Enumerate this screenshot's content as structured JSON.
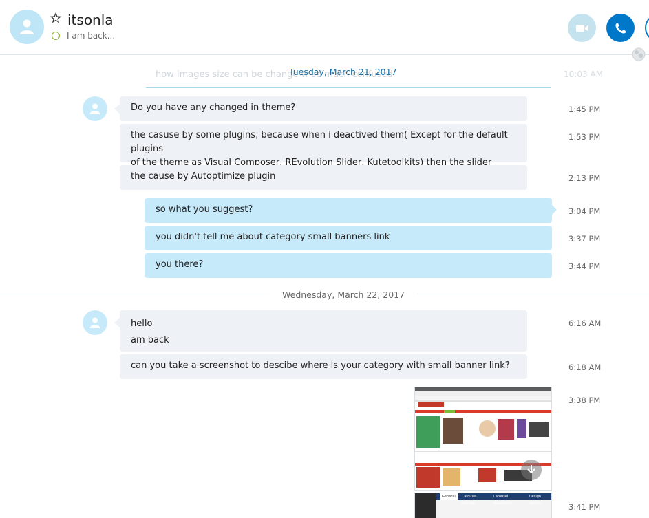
{
  "header": {
    "contact_name": "itsonla",
    "status": "I am back..."
  },
  "icons": {
    "avatar": "person-icon",
    "favorite": "star-outline-icon",
    "video_call": "video-camera-icon",
    "audio_call": "phone-icon",
    "add": "add-participant-icon",
    "download": "download-arrow-icon",
    "globe": "globe-icon"
  },
  "colors": {
    "accent": "#0078ca",
    "outgoing_bubble": "#c7eafb",
    "incoming_bubble": "#eef1f5",
    "date_link": "#1d6fa5",
    "online_ring": "#8ab53a"
  },
  "chat": {
    "faded_message": "how images size can be change w                                    so much confused",
    "faded_time": "10:03 AM",
    "date_1": "Tuesday, March 21, 2017",
    "date_2": "Wednesday, March 22, 2017",
    "messages": [
      {
        "text": "Do you have any changed in theme?",
        "time": "1:45 PM"
      },
      {
        "line1": "the casuse by some plugins, because when i deactived them( Except for the default plugins",
        "line2": "of the theme as Visual Composer, REvolution Slider, Kutetoolkits) then the slider appears",
        "time": "1:53 PM"
      },
      {
        "text": "the cause by  Autoptimize plugin",
        "time": "2:13 PM"
      },
      {
        "text": "so what you suggest?",
        "time": "3:04 PM"
      },
      {
        "text": "you didn't tell me about category small banners link",
        "time": "3:37 PM"
      },
      {
        "text": "you there?",
        "time": "3:44 PM"
      },
      {
        "line1": "hello",
        "line2": "am back",
        "time": "6:16 AM"
      },
      {
        "text": "can you take a screenshot to descibe where is your category with small banner link?",
        "time": "6:18 AM"
      },
      {
        "time": "3:38 PM"
      },
      {
        "time": "3:41 PM"
      }
    ]
  },
  "screenshot_2_tabs": [
    "General",
    "Carousel settings",
    "Carousel responsive",
    "Design options"
  ]
}
